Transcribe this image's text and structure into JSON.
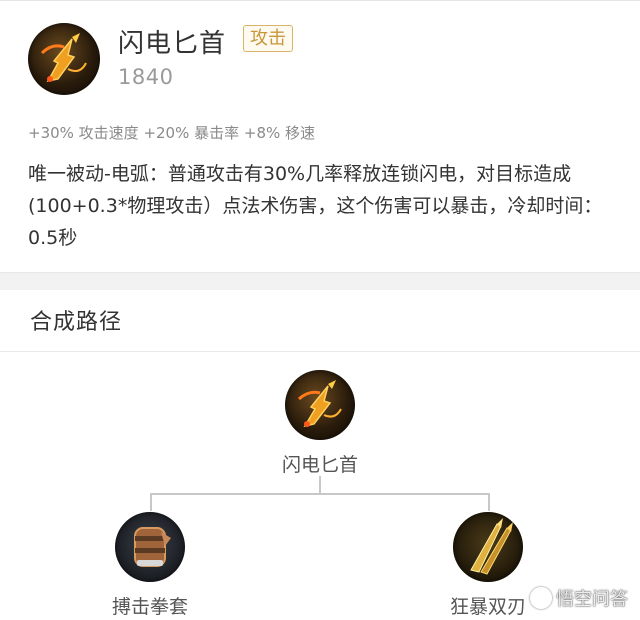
{
  "item": {
    "name": "闪电匕首",
    "tag": "攻击",
    "price": "1840",
    "stats": "+30% 攻击速度 +20% 暴击率 +8% 移速",
    "description": "唯一被动-电弧：普通攻击有30%几率释放连锁闪电，对目标造成(100+0.3*物理攻击）点法术伤害，这个伤害可以暴击，冷却时间：0.5秒",
    "icon": "lightning-dagger-icon"
  },
  "recipe": {
    "title": "合成路径",
    "root": {
      "label": "闪电匕首",
      "icon": "lightning-dagger-icon"
    },
    "components": [
      {
        "label": "搏击拳套",
        "icon": "boxing-glove-icon"
      },
      {
        "label": "狂暴双刃",
        "icon": "berserk-twin-blades-icon"
      }
    ]
  },
  "watermark": {
    "text": "悟空问答",
    "icon": "wukong-logo-icon"
  },
  "colors": {
    "tag_border": "#d8b46a",
    "tag_text": "#c8963a",
    "muted_text": "#9a9a9a",
    "divider": "#e8e8e8"
  }
}
